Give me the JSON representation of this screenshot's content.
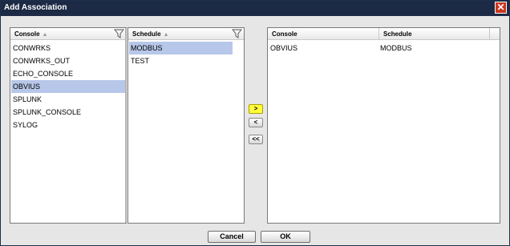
{
  "dialog": {
    "title": "Add Association",
    "close_glyph": "✕"
  },
  "console_panel": {
    "header": "Console",
    "items": [
      "CONWRKS",
      "CONWRKS_OUT",
      "ECHO_CONSOLE",
      "OBVIUS",
      "SPLUNK",
      "SPLUNK_CONSOLE",
      "SYLOG"
    ],
    "selected": "OBVIUS"
  },
  "schedule_panel": {
    "header": "Schedule",
    "items": [
      "MODBUS",
      "TEST"
    ],
    "selected": "MODBUS"
  },
  "move_buttons": {
    "add": ">",
    "remove": "<",
    "remove_all": "<<"
  },
  "association_table": {
    "columns": [
      "Console",
      "Schedule"
    ],
    "rows": [
      [
        "OBVIUS",
        "MODBUS"
      ]
    ]
  },
  "footer": {
    "cancel_label": "Cancel",
    "ok_label": "OK"
  },
  "colors": {
    "titlebar": "#1c2a45",
    "selection": "#b7c7e9",
    "highlight_button": "#ffff3a",
    "close_button": "#c9361e"
  },
  "icons": {
    "sort": "sort-up-icon",
    "filter": "filter-icon",
    "close": "close-icon"
  }
}
